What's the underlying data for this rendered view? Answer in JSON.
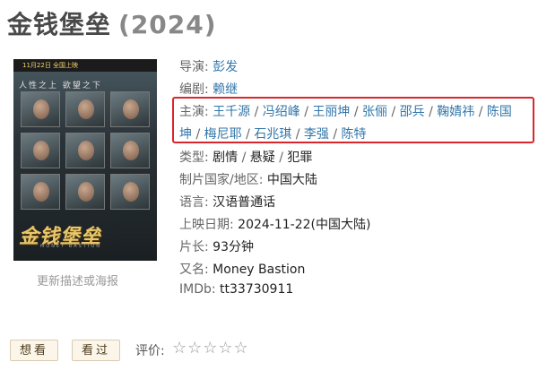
{
  "page": {
    "title": "金钱堡垒",
    "year": "(2024)"
  },
  "poster": {
    "top_text": "11月22日 全国上映",
    "subtitle": "人性之上 欲望之下",
    "name": "金钱堡垒",
    "english": "MONEY BASTION",
    "update_link": "更新描述或海报"
  },
  "info": {
    "director_label": "导演:",
    "director": "彭发",
    "writer_label": "编剧:",
    "writer": "赖继",
    "cast_label": "主演:",
    "cast_line1": [
      "王千源",
      "冯绍峰",
      "王丽坤",
      "张俪",
      "邵兵",
      "鞠婧祎",
      "陈国"
    ],
    "cast_line2": [
      "坤",
      "梅尼耶",
      "石兆琪",
      "李强",
      "陈特"
    ],
    "separator": "/",
    "genre_label": "类型:",
    "genres": [
      "剧情",
      "悬疑",
      "犯罪"
    ],
    "country_label": "制片国家/地区:",
    "country": "中国大陆",
    "language_label": "语言:",
    "language": "汉语普通话",
    "release_label": "上映日期:",
    "release": "2024-11-22(中国大陆)",
    "runtime_label": "片长:",
    "runtime": "93分钟",
    "aka_label": "又名:",
    "aka": "Money Bastion",
    "imdb_label": "IMDb:",
    "imdb": "tt33730911"
  },
  "actions": {
    "want": "想看",
    "seen": "看过",
    "rating_label": "评价:",
    "stars": "☆☆☆☆☆"
  },
  "colors": {
    "link": "#3377aa",
    "highlight_border": "#d9262c"
  }
}
